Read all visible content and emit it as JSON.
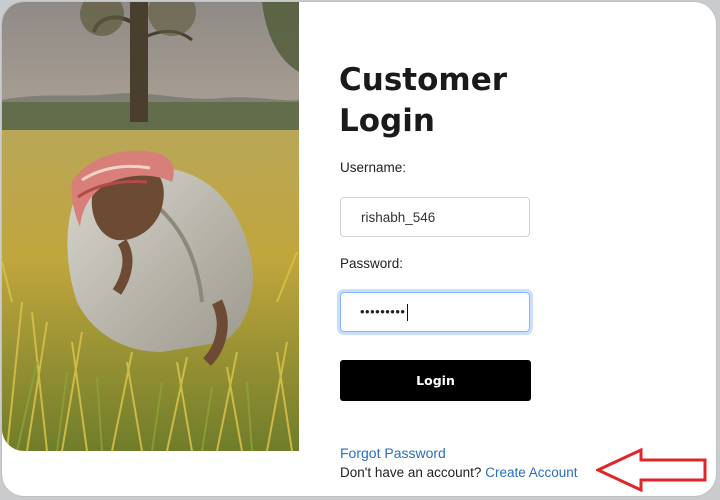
{
  "login": {
    "title": "Customer Login",
    "username_label": "Username:",
    "username_value": "rishabh_546",
    "password_label": "Password:",
    "password_masked": "•••••••••",
    "login_button": "Login",
    "forgot_link": "Forgot Password",
    "signup_prompt": "Don't have an account?",
    "signup_link": "Create Account"
  },
  "colors": {
    "accent_link": "#2a6ebf",
    "button_bg": "#000000",
    "annotation_arrow": "#e0262b"
  },
  "annotation": {
    "icon": "red-left-arrow-icon"
  }
}
